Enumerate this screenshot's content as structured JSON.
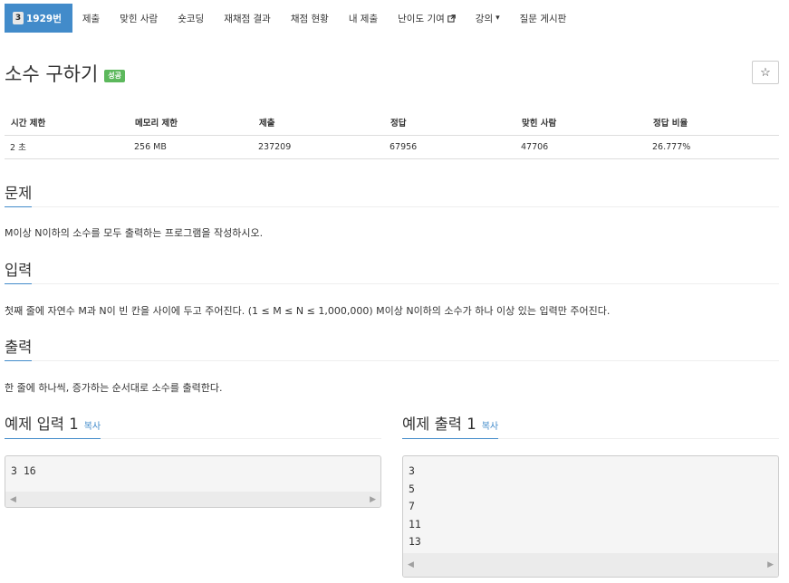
{
  "nav": {
    "problem_number": "1929번",
    "tier_badge": "3",
    "items": [
      "제출",
      "맞힌 사람",
      "숏코딩",
      "재채점 결과",
      "채점 현황",
      "내 제출",
      "난이도 기여",
      "강의",
      "질문 게시판"
    ]
  },
  "problem": {
    "title": "소수 구하기",
    "status": "성공",
    "star": "☆"
  },
  "info_table": {
    "headers": [
      "시간 제한",
      "메모리 제한",
      "제출",
      "정답",
      "맞힌 사람",
      "정답 비율"
    ],
    "values": [
      "2 초",
      "256 MB",
      "237209",
      "67956",
      "47706",
      "26.777%"
    ]
  },
  "sections": {
    "description": {
      "title": "문제",
      "text": "M이상 N이하의 소수를 모두 출력하는 프로그램을 작성하시오."
    },
    "input": {
      "title": "입력",
      "text": "첫째 줄에 자연수 M과 N이 빈 칸을 사이에 두고 주어진다. (1 ≤ M ≤ N ≤ 1,000,000) M이상 N이하의 소수가 하나 이상 있는 입력만 주어진다."
    },
    "output": {
      "title": "출력",
      "text": "한 줄에 하나씩, 증가하는 순서대로 소수를 출력한다."
    }
  },
  "samples": {
    "input": {
      "title": "예제 입력 1",
      "copy": "복사",
      "content": "3 16"
    },
    "output": {
      "title": "예제 출력 1",
      "copy": "복사",
      "content": "3\n5\n7\n11\n13"
    }
  },
  "colors": {
    "primary": "#428bca",
    "success": "#5cb85c"
  }
}
